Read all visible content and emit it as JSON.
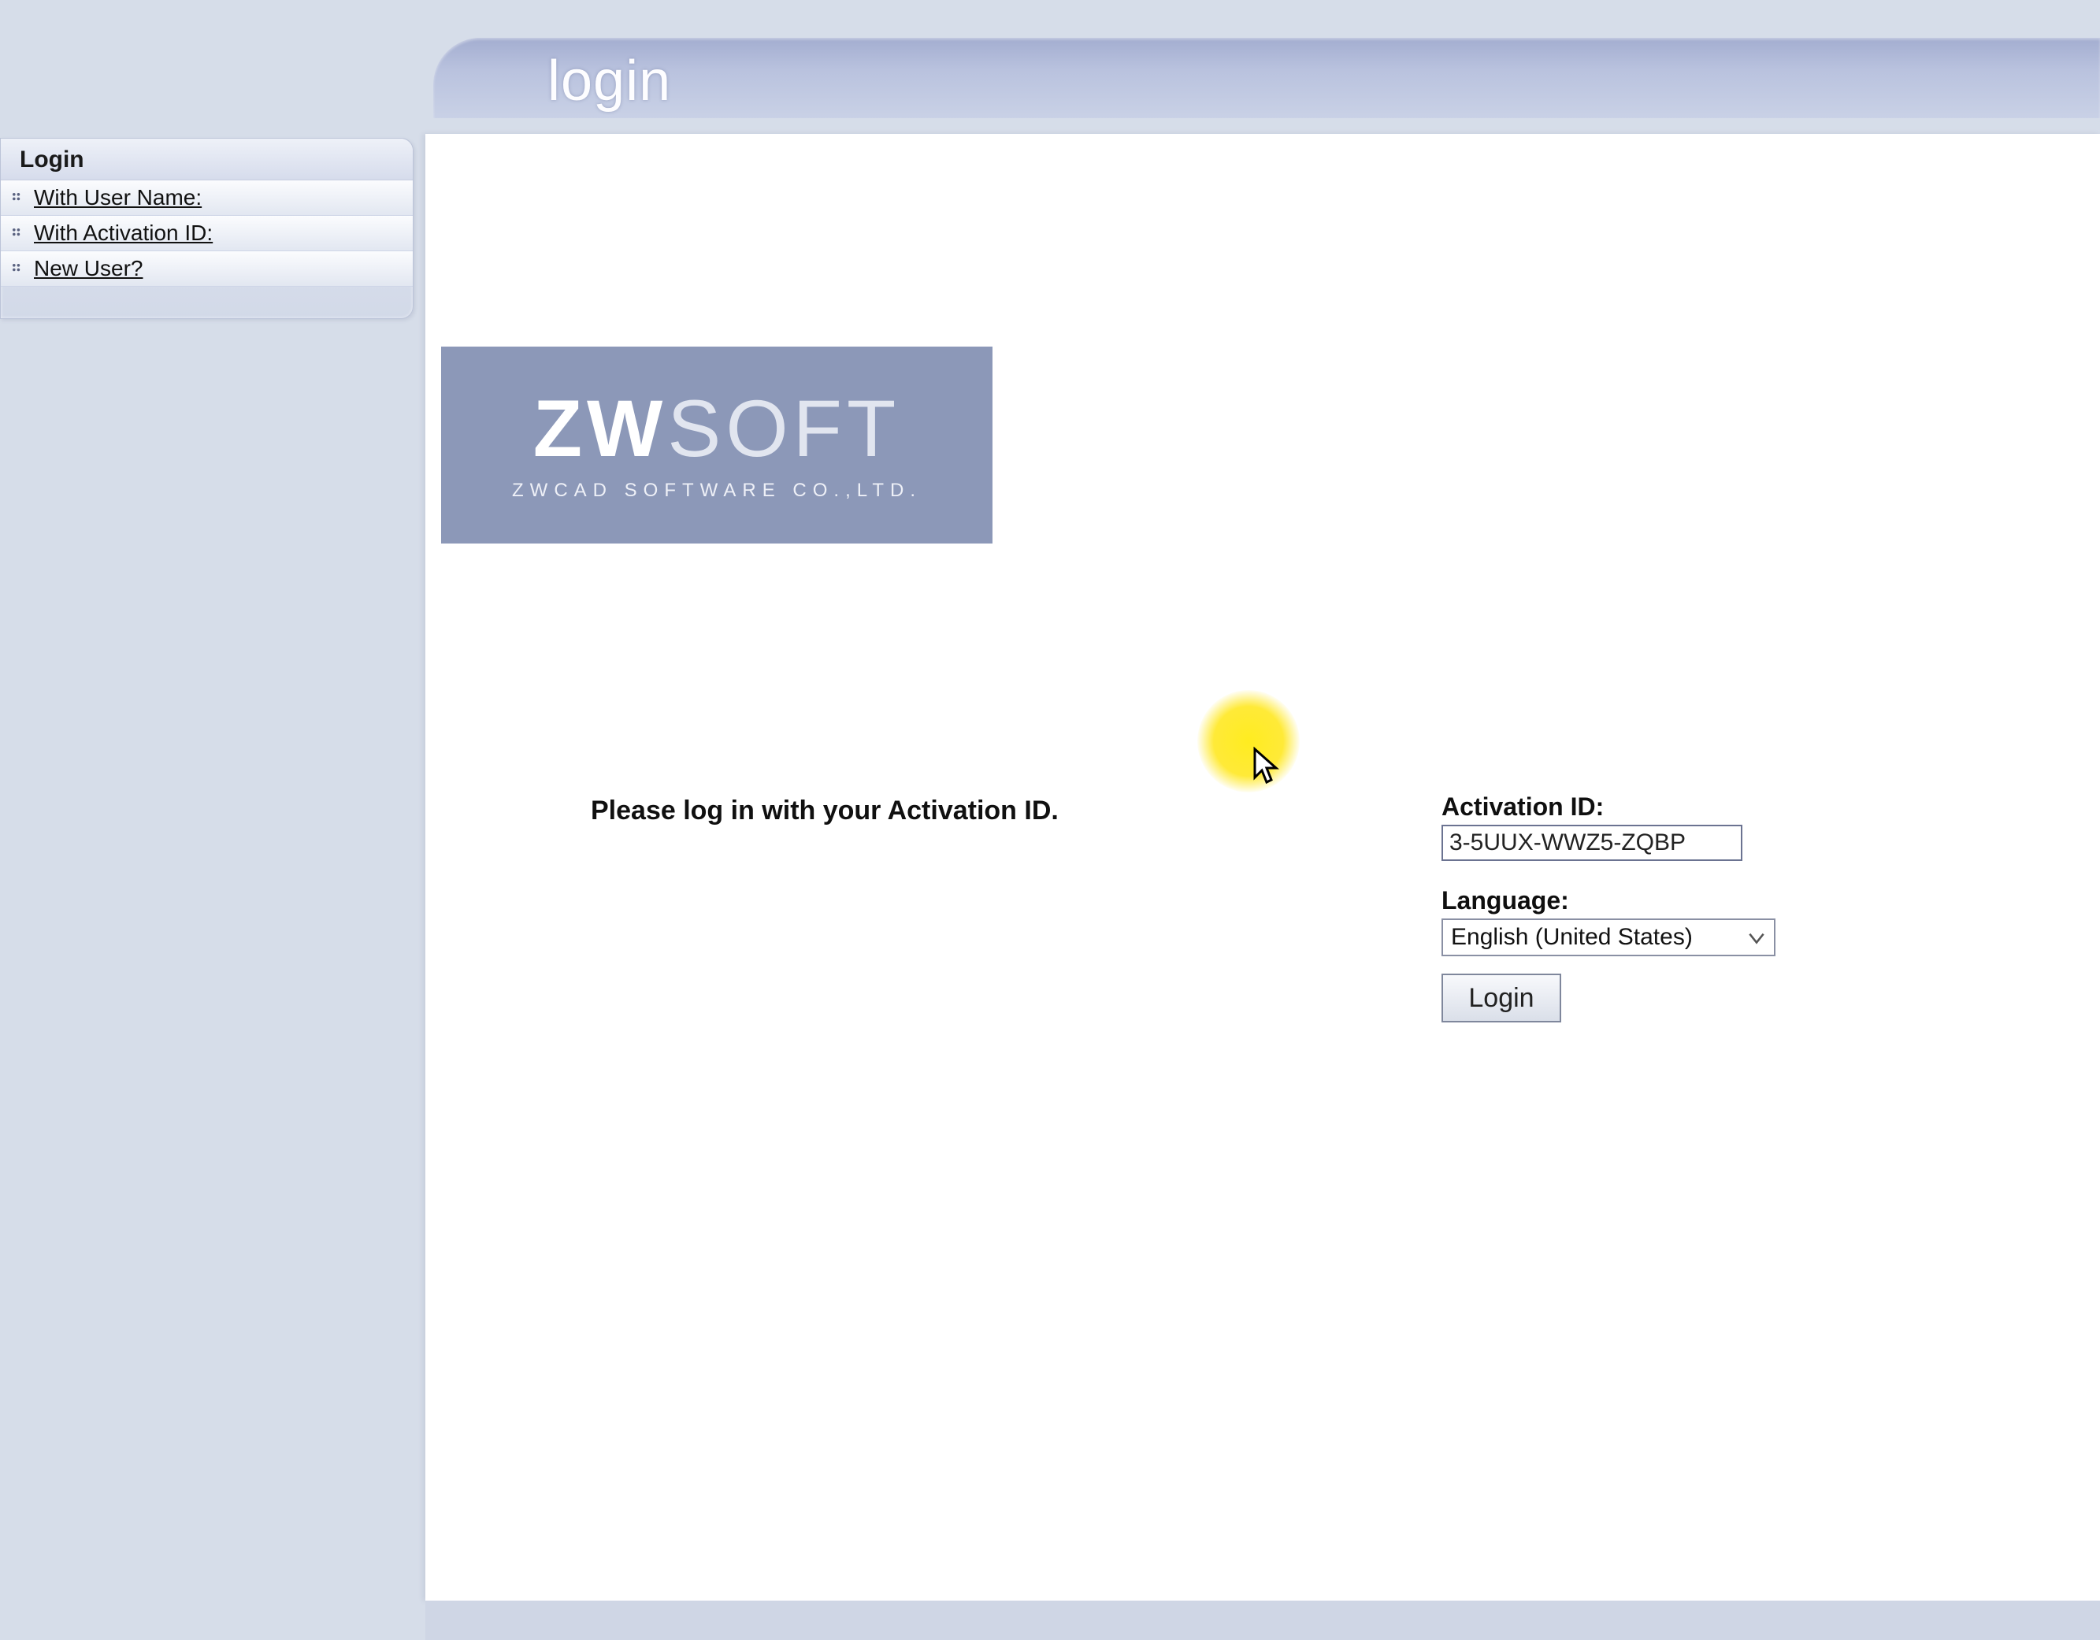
{
  "header": {
    "title": "login"
  },
  "sidebar": {
    "header": "Login",
    "items": [
      {
        "label": "With User Name:"
      },
      {
        "label": "With Activation ID:"
      },
      {
        "label": "New User?"
      }
    ]
  },
  "logo": {
    "line1_a": "ZW",
    "line1_b": "SOFT",
    "line2": "ZWCAD SOFTWARE CO.,LTD."
  },
  "main": {
    "instruction": "Please log in with your Activation ID."
  },
  "form": {
    "activation_label": "Activation ID:",
    "activation_value": "3-5UUX-WWZ5-ZQBP",
    "language_label": "Language:",
    "language_value": "English (United States)",
    "login_button": "Login"
  }
}
